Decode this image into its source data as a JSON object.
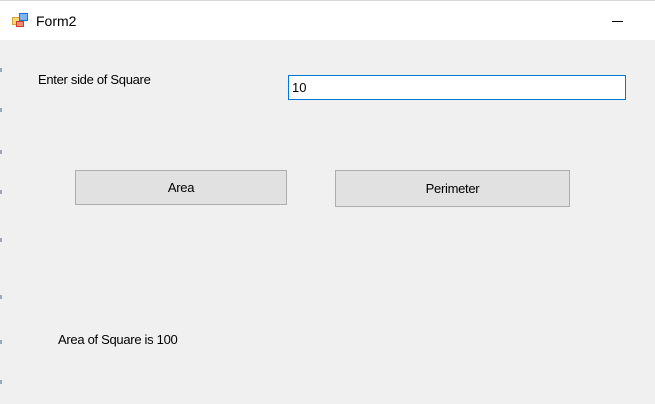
{
  "window": {
    "title": "Form2",
    "icon": "winforms-app-icon",
    "minimize_icon": "minimize-icon"
  },
  "form": {
    "side_label": "Enter side of Square",
    "side_value": "10",
    "area_button": "Area",
    "perimeter_button": "Perimeter",
    "result_text": "Area of Square is 100"
  },
  "colors": {
    "titlebar_bg": "#ffffff",
    "form_bg": "#f0f0f0",
    "button_bg": "#e1e1e1",
    "button_border": "#adadad",
    "input_focus_border": "#0078d7"
  }
}
